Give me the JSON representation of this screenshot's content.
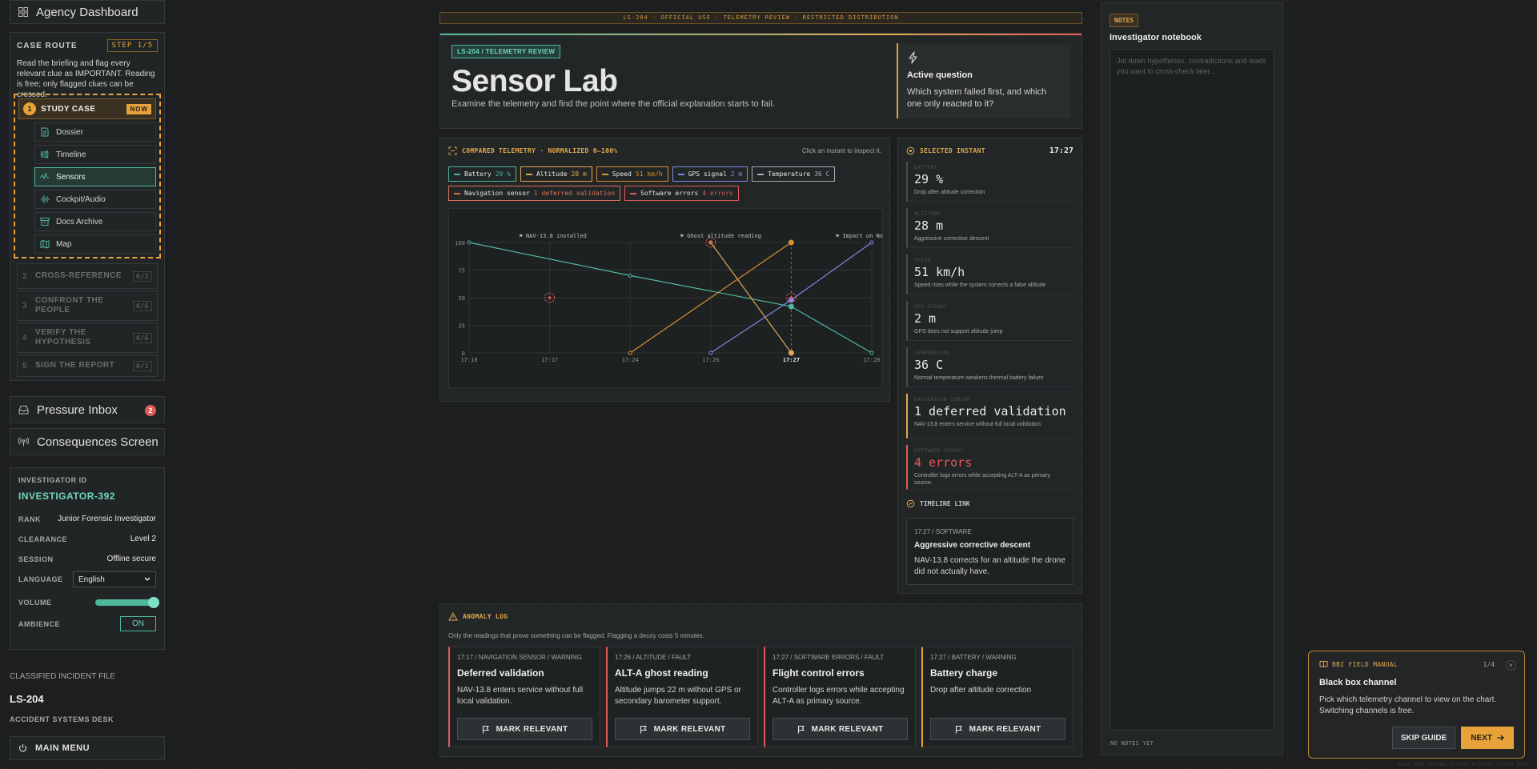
{
  "sidebar": {
    "dashboard_label": "Agency Dashboard",
    "route": {
      "title": "CASE ROUTE",
      "step": "STEP 1/5",
      "intro": "Read the briefing and flag every relevant clue as IMPORTANT. Reading is free; only flagged clues can be crossed.",
      "active_stage": {
        "num": "1",
        "label": "STUDY CASE",
        "badge": "NOW"
      },
      "sub_items": [
        {
          "label": "Dossier",
          "icon": "dossier-icon"
        },
        {
          "label": "Timeline",
          "icon": "timeline-icon"
        },
        {
          "label": "Sensors",
          "icon": "sensors-icon",
          "active": true
        },
        {
          "label": "Cockpit/Audio",
          "icon": "audio-icon"
        },
        {
          "label": "Docs Archive",
          "icon": "archive-icon"
        },
        {
          "label": "Map",
          "icon": "map-icon"
        }
      ],
      "stages": [
        {
          "num": "2",
          "label": "CROSS-REFERENCE",
          "count": "0/2"
        },
        {
          "num": "3",
          "label": "CONFRONT THE PEOPLE",
          "count": "0/6"
        },
        {
          "num": "4",
          "label": "VERIFY THE HYPOTHESIS",
          "count": "0/6"
        },
        {
          "num": "5",
          "label": "SIGN THE REPORT",
          "count": "0/1"
        }
      ]
    },
    "pressure_inbox": {
      "label": "Pressure Inbox",
      "count": "2"
    },
    "consequences_label": "Consequences Screen",
    "profile": {
      "id_label": "INVESTIGATOR ID",
      "id_value": "INVESTIGATOR-392",
      "rank_label": "RANK",
      "rank_value": "Junior Forensic Investigator",
      "clearance_label": "CLEARANCE",
      "clearance_value": "Level 2",
      "session_label": "SESSION",
      "session_value": "Offline secure",
      "language_label": "LANGUAGE",
      "language_value": "English",
      "volume_label": "VOLUME",
      "volume_level": 1.0,
      "ambience_label": "AMBIENCE",
      "ambience_value": "ON"
    },
    "case_file_label": "CLASSIFIED INCIDENT FILE",
    "case_id": "LS-204",
    "case_desk": "ACCIDENT SYSTEMS DESK",
    "main_menu_label": "MAIN MENU"
  },
  "banner": "LS-204 · OFFICIAL USE · TELEMETRY REVIEW · RESTRICTED DISTRIBUTION",
  "hero": {
    "tag": "LS-204 / TELEMETRY REVIEW",
    "title": "Sensor Lab",
    "subtitle": "Examine the telemetry and find the point where the official explanation starts to fail.",
    "question_title": "Active question",
    "question_text": "Which system failed first, and which one only reacted to it?"
  },
  "chart_panel": {
    "title": "COMPARED TELEMETRY · NORMALIZED 0–100%",
    "hint": "Click an instant to inspect it.",
    "chips": [
      {
        "name": "Battery",
        "value": "29 %",
        "color": "#4fb89c"
      },
      {
        "name": "Altitude",
        "value": "28 m",
        "color": "#e2a850"
      },
      {
        "name": "Speed",
        "value": "51 km/h",
        "color": "#d9902e"
      },
      {
        "name": "GPS signal",
        "value": "2 m",
        "color": "#7a8ce8"
      },
      {
        "name": "Temperature",
        "value": "36 C",
        "color": "#a9acb0"
      },
      {
        "name": "Navigation sensor",
        "value": "1 deferred validation",
        "color": "#e0705a"
      },
      {
        "name": "Software errors",
        "value": "4 errors",
        "color": "#e25a5a"
      }
    ]
  },
  "chart_data": {
    "type": "line",
    "title": "COMPARED TELEMETRY · NORMALIZED 0–100%",
    "x": [
      "17:10",
      "17:17",
      "17:24",
      "17:26",
      "17:27",
      "17:28"
    ],
    "ylim": [
      0,
      100
    ],
    "yticks": [
      0,
      25,
      50,
      75,
      100
    ],
    "selected_x": "17:27",
    "series": [
      {
        "name": "Battery",
        "color": "#4fb89c",
        "points": [
          [
            0,
            100
          ],
          [
            2,
            70
          ],
          [
            4,
            42
          ],
          [
            5,
            0
          ]
        ]
      },
      {
        "name": "Altitude",
        "color": "#e2a850",
        "points": [
          [
            3,
            100
          ],
          [
            4,
            0
          ]
        ]
      },
      {
        "name": "Speed",
        "color": "#d9902e",
        "points": [
          [
            2,
            0
          ],
          [
            4,
            100
          ]
        ]
      },
      {
        "name": "GPS signal",
        "color": "#7a8ce8",
        "points": [
          [
            3,
            0
          ],
          [
            4,
            48
          ],
          [
            5,
            100
          ]
        ]
      }
    ],
    "error_markers": [
      [
        1,
        50
      ],
      [
        3,
        100
      ],
      [
        4,
        50
      ]
    ],
    "annotations": [
      {
        "label": "⚑ NAV-13.8 installed",
        "x": 1
      },
      {
        "label": "⚑ Ghost altitude reading",
        "x": 3
      },
      {
        "label": "⚑ Impact on No",
        "x": 5
      }
    ]
  },
  "instant": {
    "title": "SELECTED INSTANT",
    "time": "17:27",
    "readings": [
      {
        "label": "BATTERY",
        "value": "29 %",
        "desc": "Drop after altitude correction",
        "status": "normal"
      },
      {
        "label": "ALTITUDE",
        "value": "28 m",
        "desc": "Aggressive corrective descent",
        "status": "normal"
      },
      {
        "label": "SPEED",
        "value": "51 km/h",
        "desc": "Speed rises while the system corrects a false altitude",
        "status": "normal"
      },
      {
        "label": "GPS SIGNAL",
        "value": "2 m",
        "desc": "GPS does not support altitude jump",
        "status": "normal"
      },
      {
        "label": "TEMPERATURE",
        "value": "36 C",
        "desc": "Normal temperature weakens thermal battery failure",
        "status": "normal"
      },
      {
        "label": "NAVIGATION SENSOR",
        "value": "1 deferred validation",
        "desc": "NAV-13.8 enters service without full local validation.",
        "status": "warn"
      },
      {
        "label": "SOFTWARE ERRORS",
        "value": "4 errors",
        "desc": "Controller logs errors while accepting ALT-A as primary source.",
        "status": "err"
      }
    ],
    "timeline_link_label": "TIMELINE LINK",
    "timeline": {
      "kicker": "17:27 / SOFTWARE",
      "title": "Aggressive corrective descent",
      "desc": "NAV-13.8 corrects for an altitude the drone did not actually have."
    }
  },
  "anomaly": {
    "title": "ANOMALY LOG",
    "subtitle": "Only the readings that prove something can be flagged. Flagging a decoy costs 5 minutes.",
    "button_label": "MARK RELEVANT",
    "cards": [
      {
        "kicker": "17:17 / NAVIGATION SENSOR / WARNING",
        "title": "Deferred validation",
        "desc": "NAV-13.8 enters service without full local validation.",
        "severity": "err"
      },
      {
        "kicker": "17:26 / ALTITUDE / FAULT",
        "title": "ALT-A ghost reading",
        "desc": "Altitude jumps 22 m without GPS or secondary barometer support.",
        "severity": "err"
      },
      {
        "kicker": "17:27 / SOFTWARE ERRORS / FAULT",
        "title": "Flight control errors",
        "desc": "Controller logs errors while accepting ALT-A as primary source.",
        "severity": "err"
      },
      {
        "kicker": "17:27 / BATTERY / WARNING",
        "title": "Battery charge",
        "desc": "Drop after altitude correction",
        "severity": "warn"
      }
    ]
  },
  "notes": {
    "tag": "NOTES",
    "title": "Investigator notebook",
    "placeholder": "Jot down hypotheses, contradictions and leads you want to cross-check later...",
    "footer": "NO NOTES YET"
  },
  "manual": {
    "tag": "BBI FIELD MANUAL",
    "count": "1/4",
    "close": "×",
    "title": "Black box channel",
    "text": "Pick which telemetry channel to view on the chart. Switching channels is free.",
    "skip_label": "SKIP GUIDE",
    "next_label": "NEXT"
  },
  "footer_text": "NIGHT MODE INTERNAL SYSTEMS ACCIDENT SYSTEMS DESK"
}
